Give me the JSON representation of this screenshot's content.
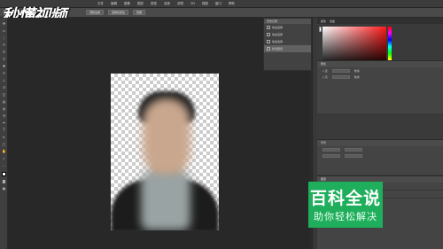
{
  "watermark": {
    "logo_text": "秒懂视频"
  },
  "menu": {
    "items": [
      "文件",
      "编辑",
      "图像",
      "图层",
      "类型",
      "选择",
      "滤镜",
      "3D",
      "视图",
      "窗口",
      "帮助"
    ]
  },
  "options_bar": {
    "buttons": [
      "调整边缘",
      "选择并遮住",
      "查看"
    ]
  },
  "history_panel": {
    "tab": "历史记录",
    "items": [
      "快速选择",
      "快速选择",
      "快速选择",
      "新建图层"
    ]
  },
  "right_panel": {
    "tabs": [
      "颜色",
      "色板"
    ],
    "adjust_title": "属性",
    "character_title": "字符",
    "layers_title": "图层",
    "rows": [
      "x 宽",
      "y 高",
      "像素",
      "像素"
    ],
    "library_label": "库",
    "layer_names": [
      "图层 1",
      "背景"
    ]
  },
  "badge": {
    "title": "百科全说",
    "subtitle": "助你轻松解决",
    "color": "#1fae5b"
  },
  "colors": {
    "foreground": "#ffffff",
    "accent": "#ff1a1a"
  }
}
